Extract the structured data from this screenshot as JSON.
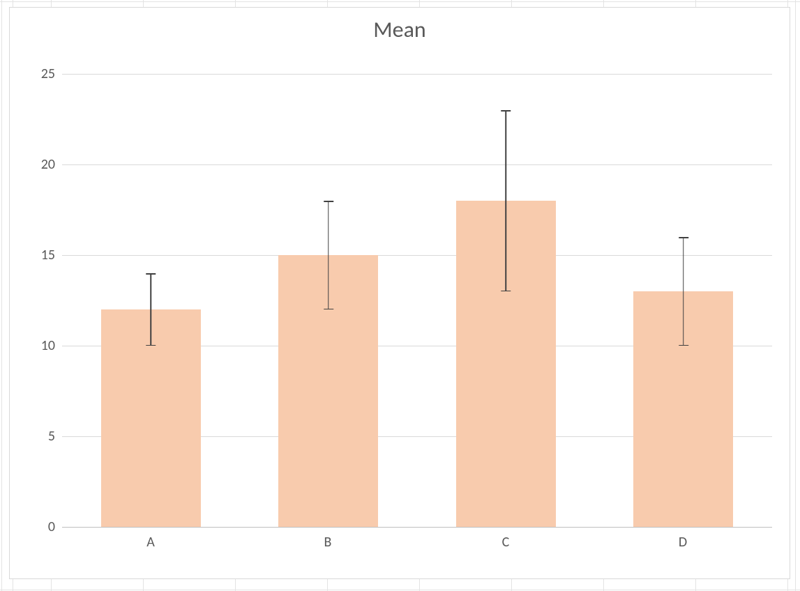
{
  "chart_data": {
    "type": "bar",
    "title": "Mean",
    "xlabel": "",
    "ylabel": "",
    "ylim": [
      0,
      25
    ],
    "yticks": [
      0,
      5,
      10,
      15,
      20,
      25
    ],
    "categories": [
      "A",
      "B",
      "C",
      "D"
    ],
    "series": [
      {
        "name": "Mean",
        "values": [
          12,
          15,
          18,
          13
        ],
        "error_plus": [
          2,
          3,
          5,
          3
        ],
        "error_minus": [
          2,
          3,
          5,
          3
        ]
      }
    ],
    "colors": {
      "bar_fill": "#f8cbad",
      "errorbar": "#404040"
    }
  }
}
